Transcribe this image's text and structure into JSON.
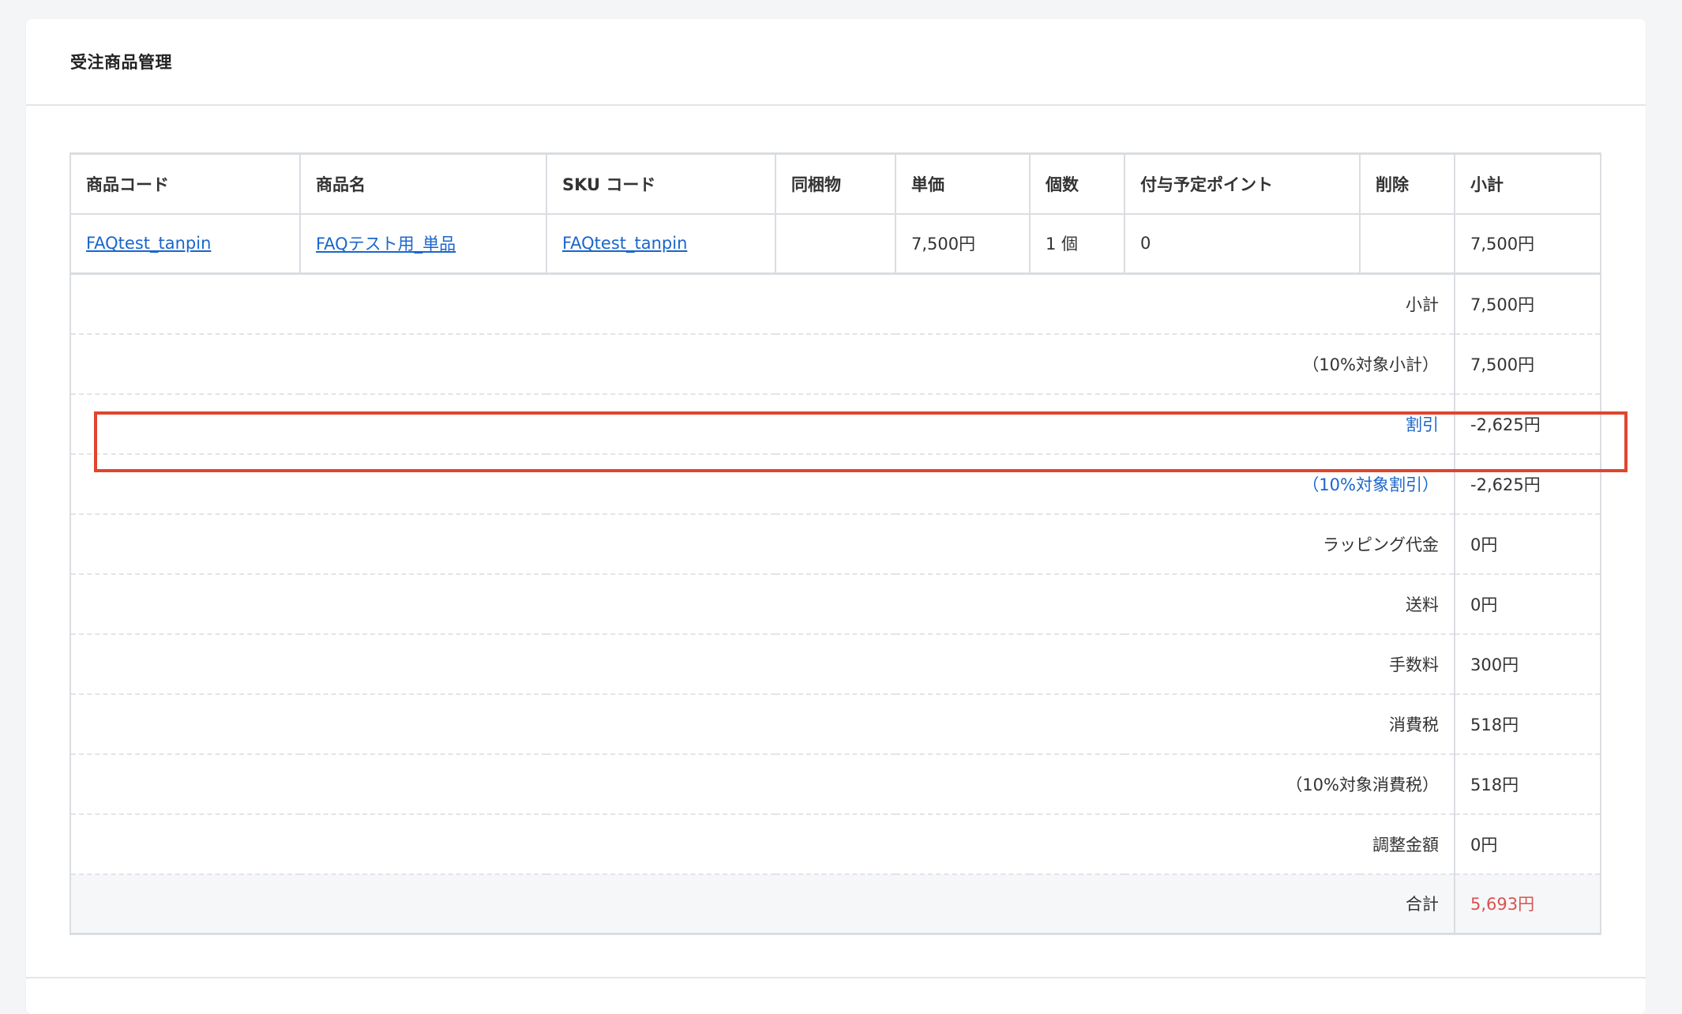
{
  "panel": {
    "title": "受注商品管理"
  },
  "columns": [
    "商品コード",
    "商品名",
    "SKU コード",
    "同梱物",
    "単価",
    "個数",
    "付与予定ポイント",
    "削除",
    "小計"
  ],
  "items": [
    {
      "product_code": "FAQtest_tanpin",
      "product_name": "FAQテスト用_単品",
      "sku_code": "FAQtest_tanpin",
      "bundle": "",
      "unit_price": "7,500円",
      "quantity": "1 個",
      "points": "0",
      "delete": "",
      "subtotal": "7,500円"
    }
  ],
  "summary": {
    "subtotal": {
      "label": "小計",
      "value": "7,500円"
    },
    "subtotal_10": {
      "label": "（10%対象小計）",
      "value": "7,500円"
    },
    "discount": {
      "label": "割引",
      "value": "-2,625円"
    },
    "discount_10": {
      "label": "（10%対象割引）",
      "value": "-2,625円"
    },
    "wrapping": {
      "label": "ラッピング代金",
      "value": "0円"
    },
    "shipping": {
      "label": "送料",
      "value": "0円"
    },
    "fee": {
      "label": "手数料",
      "value": "300円"
    },
    "tax": {
      "label": "消費税",
      "value": "518円"
    },
    "tax_10": {
      "label": "（10%対象消費税）",
      "value": "518円"
    },
    "adjustment": {
      "label": "調整金額",
      "value": "0円"
    },
    "total": {
      "label": "合計",
      "value": "5,693円"
    }
  },
  "colors": {
    "link": "#1a66cc",
    "highlight": "#e0452e",
    "total": "#d9534f"
  }
}
